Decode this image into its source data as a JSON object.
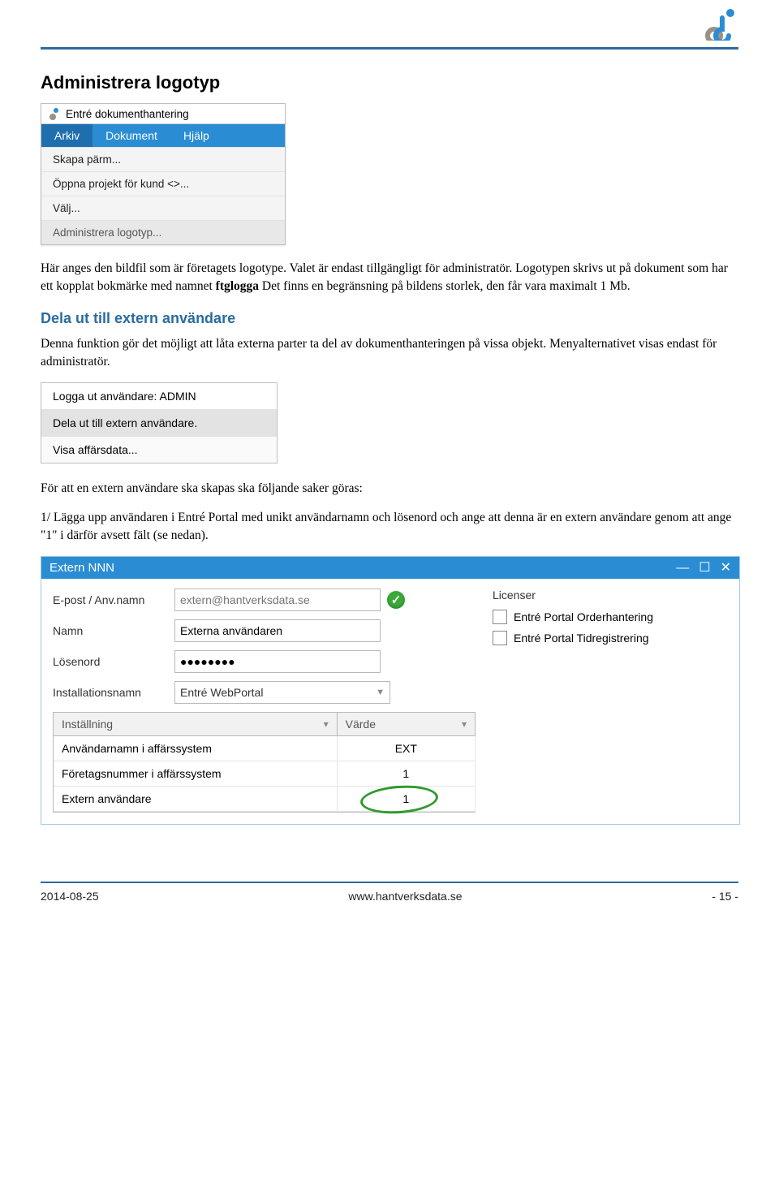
{
  "heading": "Administrera logotyp",
  "shot1": {
    "app_title": "Entré dokumenthantering",
    "menu": {
      "arkiv": "Arkiv",
      "dokument": "Dokument",
      "hjalp": "Hjälp"
    },
    "items": {
      "skapa": "Skapa pärm...",
      "oppna": "Öppna projekt för kund <>...",
      "valj": "Välj...",
      "admin": "Administrera logotyp..."
    }
  },
  "para1a": "Här anges den bildfil som är företagets logotype. Valet är endast tillgängligt för administratör. Logotypen skrivs ut på dokument som har ett kopplat bokmärke med namnet ",
  "para1b": "ftglogga",
  "para1c": " Det finns en begränsning på bildens storlek, den får vara maximalt 1 Mb.",
  "sub1": "Dela ut till extern användare",
  "para2": "Denna funktion gör det möjligt att låta externa parter ta del av dokumenthanteringen på vissa objekt. Menyalternativet visas endast för administratör.",
  "shot2": {
    "logout": "Logga ut användare:  ADMIN",
    "dela": "Dela ut  till extern användare.",
    "visa": "Visa affärsdata..."
  },
  "para3": "För att en extern användare ska skapas ska följande saker göras:",
  "para4": "1/ Lägga upp användaren i Entré Portal med unikt användarnamn och lösenord och ange att denna är en extern användare genom att ange \"1\" i därför avsett fält (se nedan).",
  "shot3": {
    "title": "Extern NNN",
    "labels": {
      "epost": "E-post / Anv.namn",
      "namn": "Namn",
      "losenord": "Lösenord",
      "install": "Installationsnamn",
      "licenser": "Licenser"
    },
    "values": {
      "epost_placeholder": "extern@hantverksdata.se",
      "namn": "Externa användaren",
      "losenord": "●●●●●●●●",
      "install": "Entré WebPortal"
    },
    "licenses": {
      "order": "Entré Portal Orderhantering",
      "tid": "Entré Portal Tidregistrering"
    },
    "table": {
      "head_setting": "Inställning",
      "head_value": "Värde",
      "rows": [
        {
          "setting": "Användarnamn i affärssystem",
          "value": "EXT"
        },
        {
          "setting": "Företagsnummer i affärssystem",
          "value": "1"
        },
        {
          "setting": "Extern användare",
          "value": "1"
        }
      ]
    }
  },
  "footer": {
    "date": "2014-08-25",
    "url": "www.hantverksdata.se",
    "page": "- 15 -"
  }
}
